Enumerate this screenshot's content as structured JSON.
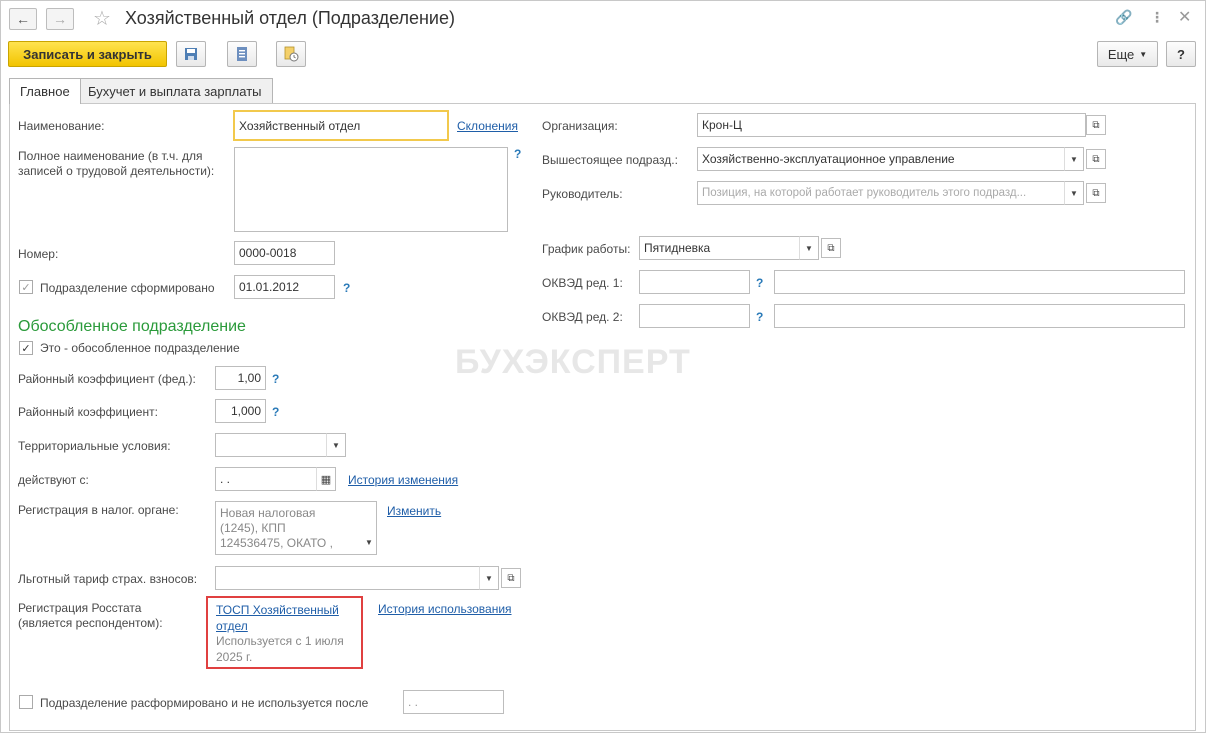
{
  "window": {
    "title": "Хозяйственный отдел (Подразделение)"
  },
  "toolbar": {
    "save_close": "Записать и закрыть",
    "more": "Еще",
    "help": "?"
  },
  "tabs": [
    {
      "label": "Главное",
      "active": true
    },
    {
      "label": "Бухучет и выплата зарплаты",
      "active": false
    }
  ],
  "left": {
    "name_label": "Наименование:",
    "name_value": "Хозяйственный отдел",
    "declension_link": "Склонения",
    "fullname_label": "Полное наименование (в т.ч. для записей о трудовой деятельности):",
    "fullname_value": "",
    "number_label": "Номер:",
    "number_value": "0000-0018",
    "formed_label": "Подразделение сформировано",
    "formed_date": "01.01.2012",
    "formed_checked": true,
    "separate_section": "Обособленное подразделение",
    "separate_label": "Это - обособленное подразделение",
    "separate_checked": true,
    "reg_coef_fed_label": "Районный коэффициент (фед.):",
    "reg_coef_fed_value": "1,00",
    "reg_coef_label": "Районный коэффициент:",
    "reg_coef_value": "1,000",
    "terr_label": "Территориальные условия:",
    "terr_value": "",
    "valid_from_label": "действуют с:",
    "valid_from_value": " .  .",
    "history_link": "История изменения",
    "tax_reg_label": "Регистрация в налог. органе:",
    "tax_reg_value": "Новая налоговая (1245), КПП 124536475, ОКАТО ,",
    "change_link": "Изменить",
    "tariff_label": "Льготный тариф страх. взносов:",
    "tariff_value": "",
    "rosstat_label": "Регистрация Росстата (является респондентом):",
    "rosstat_link": "ТОСП Хозяйственный отдел",
    "rosstat_note": "Используется с 1 июля 2025 г.",
    "usage_history_link": "История использования",
    "disbanded_label": "Подразделение расформировано и не используется после",
    "disbanded_checked": false,
    "disbanded_date": " .  ."
  },
  "right": {
    "org_label": "Организация:",
    "org_value": "Крон-Ц",
    "parent_label": "Вышестоящее подразд.:",
    "parent_value": "Хозяйственно-эксплуатационное управление",
    "head_label": "Руководитель:",
    "head_placeholder": "Позиция, на которой работает руководитель этого подразд...",
    "schedule_label": "График работы:",
    "schedule_value": "Пятидневка",
    "okved1_label": "ОКВЭД ред. 1:",
    "okved2_label": "ОКВЭД ред. 2:"
  },
  "watermark": "БУХЭКСПЕРТ",
  "colors": {
    "accent": "#f2c400",
    "link": "#1f5ea8",
    "section": "#2a9a3a",
    "highlight_box": "#e04040"
  }
}
